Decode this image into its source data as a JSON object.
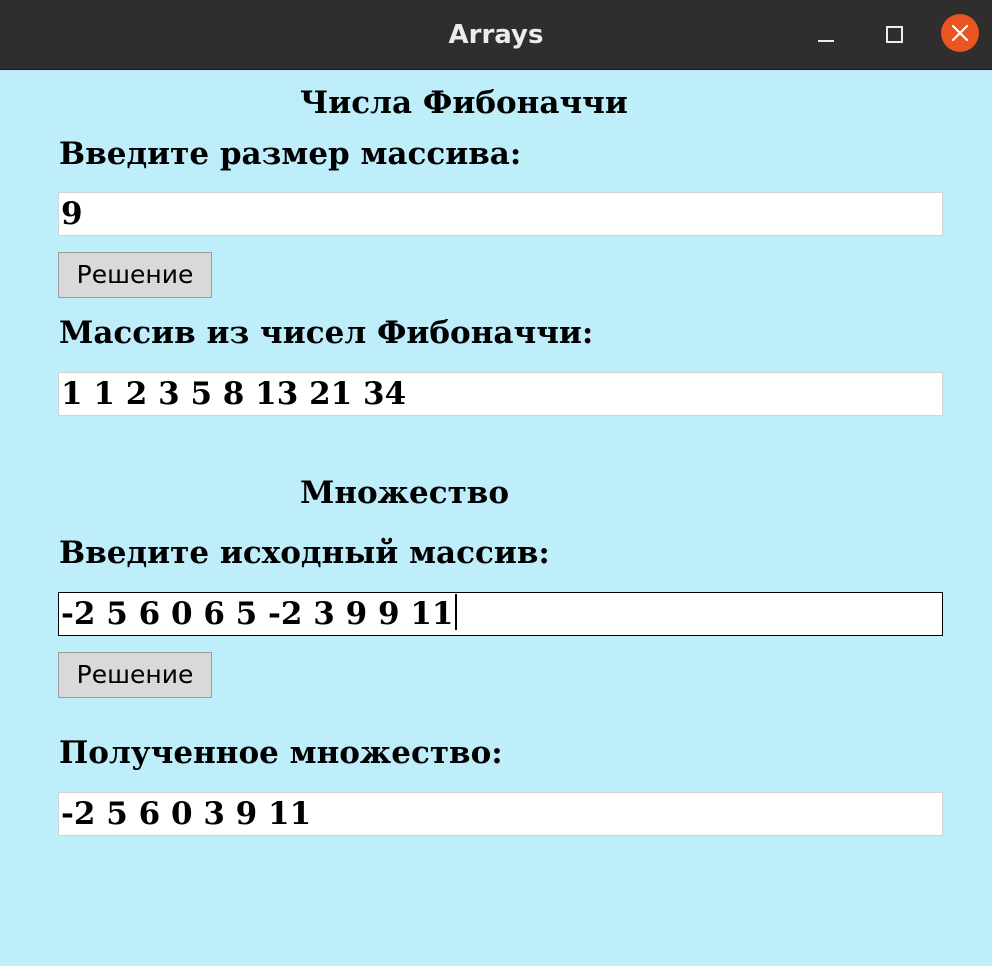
{
  "window": {
    "title": "Arrays",
    "controls": [
      "minimize-icon",
      "maximize-icon",
      "close-icon"
    ]
  },
  "fibonacci": {
    "section_title": "Числа Фибоначчи",
    "size_label": "Введите размер массива:",
    "size_value": "9",
    "solve_label": "Решение",
    "result_label": "Массив из чисел Фибоначчи:",
    "result_value": "1 1 2 3 5 8 13 21 34"
  },
  "set": {
    "section_title": "Множество",
    "input_label": "Введите исходный массив:",
    "input_value": "-2 5 6 0 6 5 -2 3 9 9 11",
    "solve_label": "Решение",
    "result_label": "Полученное множество:",
    "result_value": "-2 5 6 0 3 9 11"
  },
  "colors": {
    "background": "#bfeefb",
    "titlebar": "#302d2e",
    "close_button": "#e95420"
  }
}
